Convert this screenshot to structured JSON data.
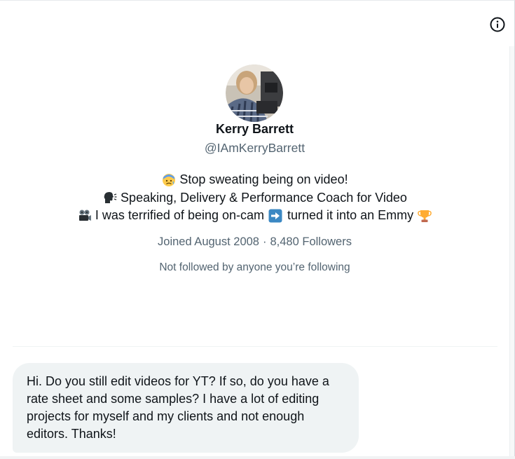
{
  "profile": {
    "name": "Kerry Barrett",
    "handle": "@IAmKerryBarrett",
    "bio": [
      {
        "icon": "anxious-sweat-face-icon",
        "text": "Stop sweating being on video!"
      },
      {
        "icon": "speaking-head-icon",
        "text": "Speaking, Delivery & Performance Coach for Video"
      },
      {
        "icon": "movie-camera-icon",
        "text_before": "I was terrified of being on-cam",
        "icon_mid": "right-arrow-icon",
        "text_after": "turned it into an Emmy",
        "icon_end": "trophy-icon"
      }
    ],
    "joined": "Joined August 2008",
    "separator": "·",
    "followers": "8,480 Followers",
    "followed_by": "Not followed by anyone you’re following"
  },
  "message": {
    "text": "Hi. Do you still edit videos for YT? If so, do you have a rate sheet and some samples? I have a lot of editing projects for myself and my clients and not enough editors. Thanks!"
  },
  "colors": {
    "primary_text": "#0f1419",
    "secondary_text": "#536471",
    "bubble_bg": "#eff3f4",
    "accent_blue": "#1d9bf0"
  }
}
